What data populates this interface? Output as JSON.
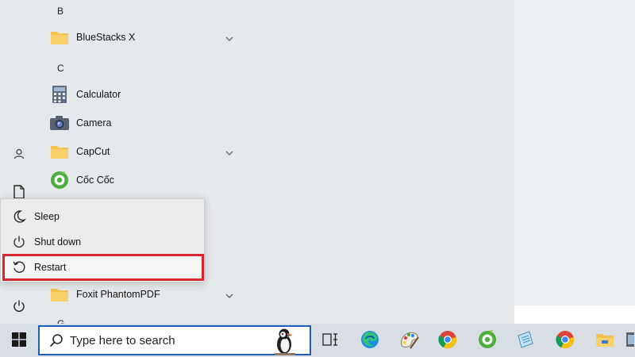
{
  "app_list": {
    "letters": [
      "B",
      "C",
      "G"
    ],
    "apps": [
      {
        "label": "BlueStacks X",
        "icon": "folder-icon",
        "expandable": true
      },
      {
        "label": "Calculator",
        "icon": "calculator-icon",
        "expandable": false
      },
      {
        "label": "Camera",
        "icon": "camera-icon",
        "expandable": false
      },
      {
        "label": "CapCut",
        "icon": "folder-icon",
        "expandable": true
      },
      {
        "label": "Cốc Cốc",
        "icon": "coccoc-icon",
        "expandable": false
      },
      {
        "label": "Foxit PhantomPDF",
        "icon": "folder-icon",
        "expandable": true
      }
    ]
  },
  "left_rail": {
    "icons": [
      "user-icon",
      "document-icon",
      "power-icon"
    ]
  },
  "power_menu": {
    "items": [
      {
        "label": "Sleep",
        "icon": "moon-icon"
      },
      {
        "label": "Shut down",
        "icon": "power-icon"
      },
      {
        "label": "Restart",
        "icon": "restart-icon",
        "highlighted": true
      }
    ]
  },
  "taskbar": {
    "search_placeholder": "Type here to search",
    "pinned_apps": [
      "task-view-icon",
      "edge-icon",
      "paint-icon",
      "chrome-icon",
      "coccoc-icon",
      "notepad-icon",
      "chrome-icon",
      "file-explorer-icon"
    ]
  },
  "colors": {
    "highlight_border": "#d8272e",
    "search_border": "#1e5fb4",
    "folder_yellow": "#f2c14e"
  }
}
